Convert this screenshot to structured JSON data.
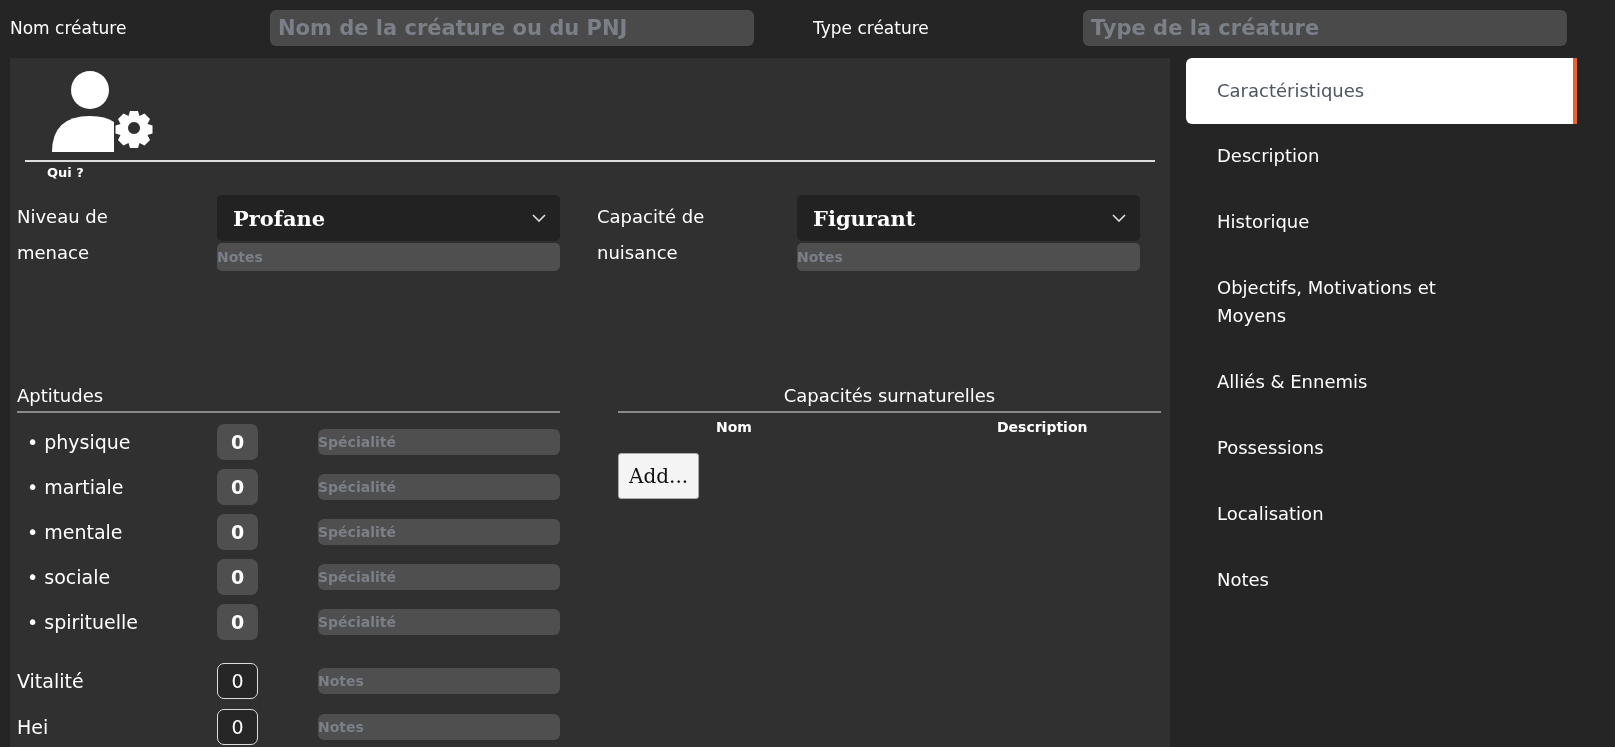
{
  "header": {
    "name_label": "Nom créature",
    "name_placeholder": "Nom de la créature ou du PNJ",
    "type_label": "Type créature",
    "type_placeholder": "Type de la créature"
  },
  "who": {
    "label": "Qui ?"
  },
  "threat": [
    {
      "label": "Niveau de menace",
      "value": "Profane",
      "notes_placeholder": "Notes"
    },
    {
      "label": "Capacité de nuisance",
      "value": "Figurant",
      "notes_placeholder": "Notes"
    }
  ],
  "aptitudes": {
    "title": "Aptitudes",
    "rows": [
      {
        "label": "• physique",
        "value": "0",
        "placeholder": "Spécialité"
      },
      {
        "label": "• martiale",
        "value": "0",
        "placeholder": "Spécialité"
      },
      {
        "label": "• mentale",
        "value": "0",
        "placeholder": "Spécialité"
      },
      {
        "label": "• sociale",
        "value": "0",
        "placeholder": "Spécialité"
      },
      {
        "label": "• spirituelle",
        "value": "0",
        "placeholder": "Spécialité"
      }
    ]
  },
  "stats": [
    {
      "label": "Vitalité",
      "value": "0",
      "placeholder": "Notes"
    },
    {
      "label": "Hei",
      "value": "0",
      "placeholder": "Notes"
    }
  ],
  "supernatural": {
    "title": "Capacités surnaturelles",
    "columns": [
      "Nom",
      "Description"
    ],
    "add_button": "Add..."
  },
  "tabs": [
    {
      "label": "Caractéristiques",
      "selected": true
    },
    {
      "label": "Description",
      "selected": false
    },
    {
      "label": "Historique",
      "selected": false
    },
    {
      "label": "Objectifs, Motivations et Moyens",
      "selected": false
    },
    {
      "label": "Alliés & Ennemis",
      "selected": false
    },
    {
      "label": "Possessions",
      "selected": false
    },
    {
      "label": "Localisation",
      "selected": false
    },
    {
      "label": "Notes",
      "selected": false
    }
  ]
}
